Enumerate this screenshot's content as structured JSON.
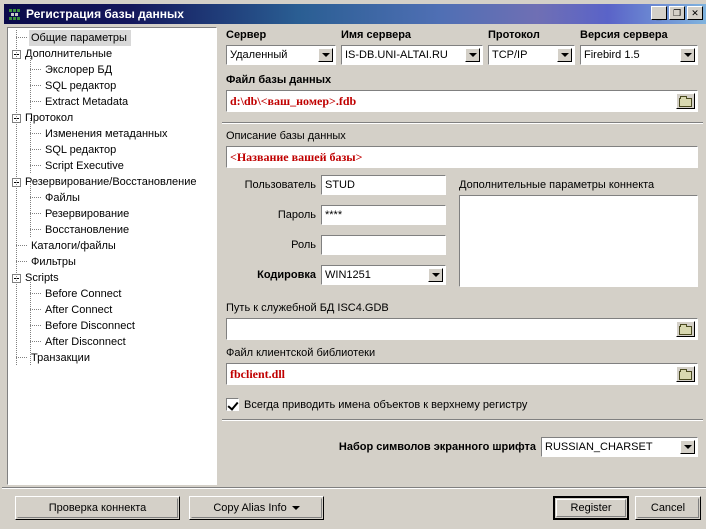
{
  "window": {
    "title": "Регистрация базы данных",
    "icon": "database-registration-icon",
    "minimize_label": "_",
    "maximize_label": "❐",
    "close_label": "✕"
  },
  "tree": {
    "items": [
      {
        "label": "Общие параметры",
        "level": 1,
        "expander": "none",
        "selected": true
      },
      {
        "label": "Дополнительные",
        "level": 0,
        "expander": "minus",
        "selected": false
      },
      {
        "label": "Экслорер БД",
        "level": 2,
        "expander": "none",
        "selected": false
      },
      {
        "label": "SQL редактор",
        "level": 2,
        "expander": "none",
        "selected": false
      },
      {
        "label": "Extract Metadata",
        "level": 2,
        "expander": "none",
        "selected": false
      },
      {
        "label": "Протокол",
        "level": 0,
        "expander": "minus",
        "selected": false
      },
      {
        "label": "Изменения метаданных",
        "level": 2,
        "expander": "none",
        "selected": false
      },
      {
        "label": "SQL редактор",
        "level": 2,
        "expander": "none",
        "selected": false
      },
      {
        "label": "Script Executive",
        "level": 2,
        "expander": "none",
        "selected": false
      },
      {
        "label": "Резервирование/Восстановление",
        "level": 0,
        "expander": "minus",
        "selected": false
      },
      {
        "label": "Файлы",
        "level": 2,
        "expander": "none",
        "selected": false
      },
      {
        "label": "Резервирование",
        "level": 2,
        "expander": "none",
        "selected": false
      },
      {
        "label": "Восстановление",
        "level": 2,
        "expander": "none",
        "selected": false
      },
      {
        "label": "Каталоги/файлы",
        "level": 1,
        "expander": "none",
        "selected": false
      },
      {
        "label": "Фильтры",
        "level": 1,
        "expander": "none",
        "selected": false
      },
      {
        "label": "Scripts",
        "level": 0,
        "expander": "minus",
        "selected": false
      },
      {
        "label": "Before Connect",
        "level": 2,
        "expander": "none",
        "selected": false
      },
      {
        "label": "After Connect",
        "level": 2,
        "expander": "none",
        "selected": false
      },
      {
        "label": "Before Disconnect",
        "level": 2,
        "expander": "none",
        "selected": false
      },
      {
        "label": "After Disconnect",
        "level": 2,
        "expander": "none",
        "selected": false
      },
      {
        "label": "Транзакции",
        "level": 1,
        "expander": "none",
        "selected": false
      }
    ]
  },
  "form": {
    "server_label": "Сервер",
    "server_value": "Удаленный",
    "server_name_label": "Имя сервера",
    "server_name_value": "IS-DB.UNI-ALTAI.RU",
    "protocol_label": "Протокол",
    "protocol_value": "TCP/IP",
    "server_version_label": "Версия сервера",
    "server_version_value": "Firebird 1.5",
    "db_file_label": "Файл базы данных",
    "db_file_value": "d:\\db\\<ваш_номер>.fdb",
    "db_desc_label": "Описание базы данных",
    "db_desc_value": "<Название вашей базы>",
    "user_label": "Пользователь",
    "user_value": "STUD",
    "password_label": "Пароль",
    "password_value": "****",
    "role_label": "Роль",
    "role_value": "",
    "charset_label": "Кодировка",
    "charset_value": "WIN1251",
    "extra_params_label": "Дополнительные параметры коннекта",
    "extra_params_value": "",
    "isc4_label": "Путь к служебной БД ISC4.GDB",
    "isc4_value": "",
    "client_lib_label": "Файл клиентской библиотеки",
    "client_lib_value": "fbclient.dll",
    "uppercase_checkbox_label": "Всегда приводить имена объектов к верхнему регистру",
    "uppercase_checked": true,
    "screen_charset_label": "Набор символов экранного шрифта",
    "screen_charset_value": "RUSSIAN_CHARSET",
    "browse_icon": "folder-open-icon",
    "dropdown_icon": "chevron-down-icon"
  },
  "buttons": {
    "test_connect": "Проверка коннекта",
    "copy_alias_info": "Copy Alias Info",
    "register": "Register",
    "cancel": "Cancel"
  },
  "colors": {
    "face": "#d4d0c8",
    "red_text": "#c00000",
    "title_start": "#0a0a4a",
    "title_end": "#7fb3de"
  }
}
